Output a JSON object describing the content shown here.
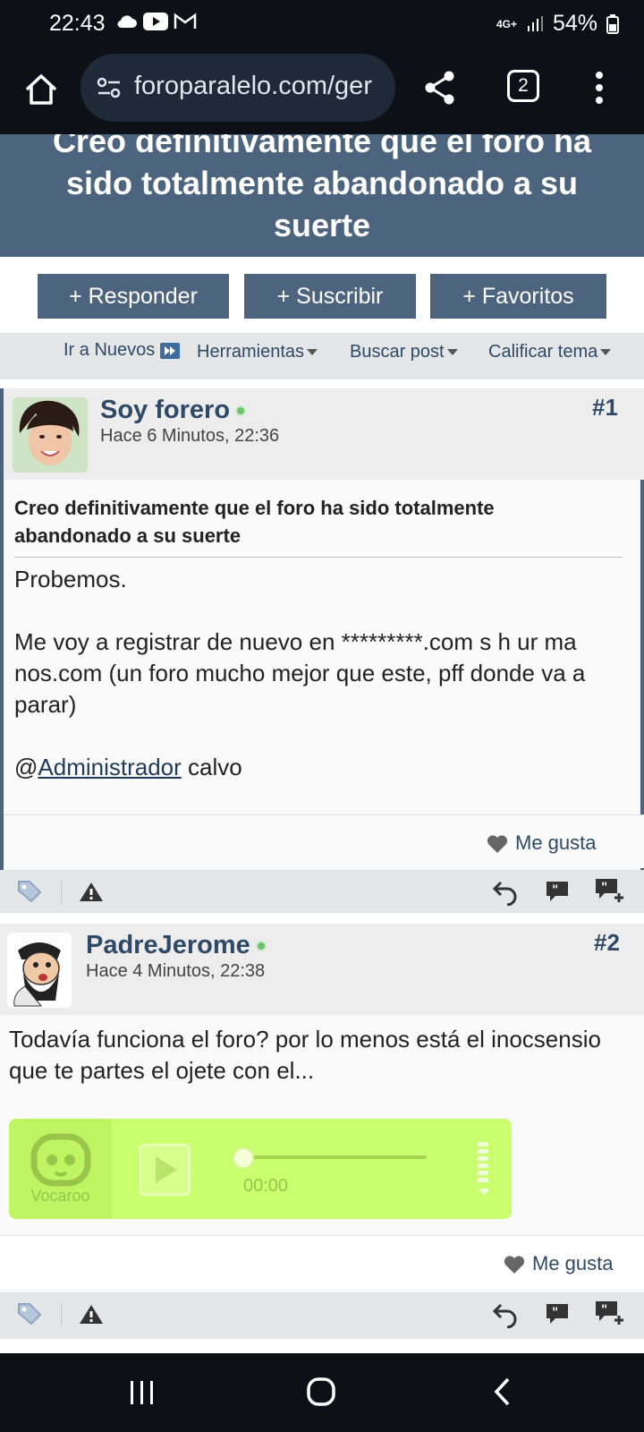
{
  "status_bar": {
    "time": "22:43",
    "network": "4G+",
    "battery": "54%",
    "icons": [
      "cloud-icon",
      "youtube-icon",
      "gmail-icon",
      "signal-icon",
      "battery-icon"
    ]
  },
  "browser": {
    "url": "foroparalelo.com/ger",
    "tab_count": "2"
  },
  "thread": {
    "title": "Creo definitivamente que el foro ha sido totalmente abandonado a su suerte"
  },
  "actions": {
    "reply": "+ Responder",
    "subscribe": "+ Suscribir",
    "favorites": "+ Favoritos"
  },
  "tools": {
    "go_new": "Ir a Nuevos",
    "tools": "Herramientas",
    "search": "Buscar post",
    "rate": "Calificar tema"
  },
  "posts": [
    {
      "username": "Soy forero",
      "date": "Hace 6 Minutos, 22:36",
      "number": "#1",
      "title": "Creo definitivamente que el foro ha sido totalmente abandonado a su suerte",
      "body_line1": "Probemos.",
      "body_line2": "Me voy a registrar de nuevo en *********.com s h ur ma nos.com (un foro mucho mejor que este, pff donde va a parar)",
      "mention_prefix": "@",
      "mention": "Administrador",
      "mention_suffix": " calvo",
      "like": "Me gusta"
    },
    {
      "username": "PadreJerome",
      "date": "Hace 4 Minutos, 22:38",
      "number": "#2",
      "body": "Todavía funciona el foro? por lo menos está el inocsensio que te partes el ojete con el...",
      "vocaroo_label": "Vocaroo",
      "vocaroo_time": "00:00",
      "like": "Me gusta"
    }
  ],
  "colors": {
    "header_bg": "#4d647e",
    "link": "#2f4a66",
    "vocaroo": "#c9ff6f"
  }
}
